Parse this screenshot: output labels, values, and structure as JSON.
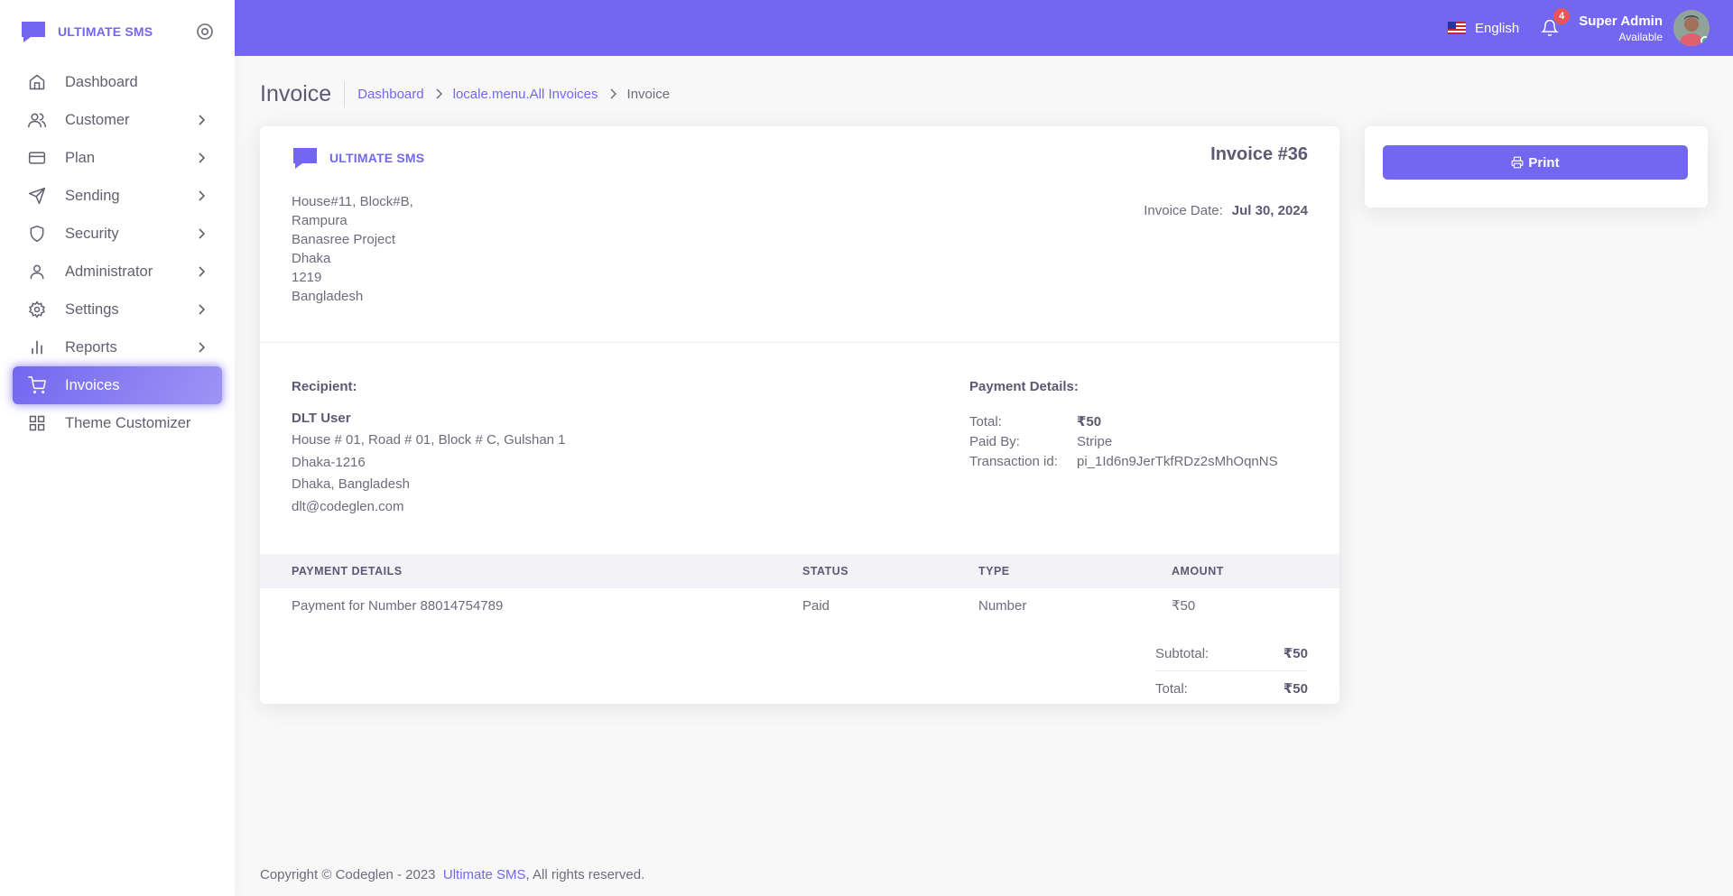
{
  "brand": {
    "name": "ULTIMATE SMS"
  },
  "sidebar": {
    "items": [
      {
        "label": "Dashboard",
        "icon": "home-icon"
      },
      {
        "label": "Customer",
        "icon": "users-icon"
      },
      {
        "label": "Plan",
        "icon": "credit-card-icon"
      },
      {
        "label": "Sending",
        "icon": "send-icon"
      },
      {
        "label": "Security",
        "icon": "shield-icon"
      },
      {
        "label": "Administrator",
        "icon": "user-icon"
      },
      {
        "label": "Settings",
        "icon": "gear-icon"
      },
      {
        "label": "Reports",
        "icon": "bar-chart-icon"
      },
      {
        "label": "Invoices",
        "icon": "shopping-cart-icon",
        "active": true
      },
      {
        "label": "Theme Customizer",
        "icon": "grid-icon"
      }
    ]
  },
  "header": {
    "language": "English",
    "notifications_count": "4",
    "user_name": "Super Admin",
    "user_status": "Available"
  },
  "page": {
    "title": "Invoice",
    "breadcrumb": [
      "Dashboard",
      "locale.menu.All Invoices",
      "Invoice"
    ]
  },
  "invoice": {
    "number": "Invoice #36",
    "date_label": "Invoice Date:",
    "date_value": "Jul 30, 2024",
    "address": [
      "House#11, Block#B,",
      "Rampura",
      "Banasree Project",
      "Dhaka",
      "1219",
      "Bangladesh"
    ],
    "recipient": {
      "heading": "Recipient:",
      "name": "DLT User",
      "lines": [
        "House # 01, Road # 01, Block # C, Gulshan 1",
        "Dhaka-1216",
        "Dhaka, Bangladesh",
        "dlt@codeglen.com"
      ]
    },
    "payment": {
      "heading": "Payment Details:",
      "total_label": "Total:",
      "total_value": "₹50",
      "paid_by_label": "Paid By:",
      "paid_by_value": "Stripe",
      "txn_label": "Transaction id:",
      "txn_value": "pi_1Id6n9JerTkfRDz2sMhOqnNS"
    },
    "table": {
      "headers": [
        "PAYMENT DETAILS",
        "STATUS",
        "TYPE",
        "AMOUNT"
      ],
      "rows": [
        [
          "Payment for Number 88014754789",
          "Paid",
          "Number",
          "₹50"
        ]
      ]
    },
    "totals": {
      "subtotal_label": "Subtotal:",
      "subtotal_value": "₹50",
      "total_label": "Total:",
      "total_value": "₹50"
    }
  },
  "actions": {
    "print_label": "Print"
  },
  "footer": {
    "prefix": "Copyright © Codeglen - 2023",
    "link": "Ultimate SMS",
    "suffix": ", All rights reserved."
  },
  "colors": {
    "primary": "#7367f0",
    "danger": "#ea5455"
  }
}
